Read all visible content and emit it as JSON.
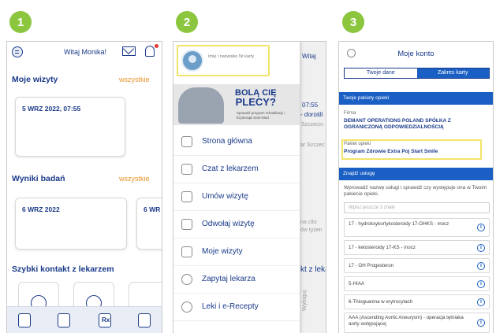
{
  "steps": [
    "1",
    "2",
    "3"
  ],
  "phone1": {
    "greeting": "Witaj Monika!",
    "visits_heading": "Moje wizyty",
    "visits_link": "wszystkie",
    "visit_date": "5 WRZ 2022, 07:55",
    "results_heading": "Wyniki badań",
    "results_link": "wszystkie",
    "result_date_1": "6 WRZ 2022",
    "result_date_2": "6 WR",
    "contact_heading": "Szybki kontakt z lekarzem",
    "nav_rx_glyph": "Rx"
  },
  "phone2": {
    "profile_text": "Imię i nazwisko Nr karty",
    "banner_title_1": "BOLĄ CIĘ",
    "banner_title_2": "PLECY?",
    "banner_sub": "Sprawdź program rehabilitacji i fizjoterapii Enel-Med",
    "menu": [
      {
        "label": "Strona główna",
        "icon": "home-icon"
      },
      {
        "label": "Czat z lekarzem",
        "icon": "chat-doctor-icon"
      },
      {
        "label": "Umów wizytę",
        "icon": "calendar-icon"
      },
      {
        "label": "Odwołaj wizytę",
        "icon": "calendar-cancel-icon"
      },
      {
        "label": "Moje wizyty",
        "icon": "calendar-list-icon"
      },
      {
        "label": "Zapytaj lekarza",
        "icon": "question-icon"
      },
      {
        "label": "Leki i e-Recepty",
        "icon": "pill-icon"
      }
    ],
    "bg_witaj": "Witaj",
    "bg_time": "07:55",
    "bg_doroslych": "- dorośli",
    "bg_szczecin": "Szczecin",
    "bg_address": "ar Szczec",
    "bg_cito": "na cito",
    "bg_tyzen": "ów tyzen",
    "bg_lekarz": "kt z leka",
    "bg_wyloguj": "Wyloguj"
  },
  "phone3": {
    "title": "Moje konto",
    "tab_data": "Twoje dane",
    "tab_card": "Zakres karty",
    "packages_bar": "Twoje pakiety opieki",
    "company_label": "Firma",
    "company_name": "DEMANT OPERATIONS POLAND SPÓŁKA Z OGRANICZONĄ ODPOWIEDZIALNOŚCIĄ",
    "package_label": "Pakiet opieki",
    "package_name": "Program Zdrowie Extra Poj Start Smile",
    "find_bar": "Znajdź usługę",
    "find_desc": "Wprowadź nazwę usługi i sprawdź czy występuje ona w Twoim pakiecie opieki.",
    "search_placeholder": "Wpisz jeszcze 3 znaki",
    "services": [
      "17 - hydroksykortykosteroidy 17-OHKS - mocz",
      "17 - ketosteroidy 17-KS - mocz",
      "17 - OH Progesteron",
      "5-HIAA",
      "6-Thioguanina w erytrocytach",
      "AAA (Ascending Aortic Aneurysm) - operacja tętniaka aorty wstępującej"
    ],
    "info_glyph": "i"
  }
}
